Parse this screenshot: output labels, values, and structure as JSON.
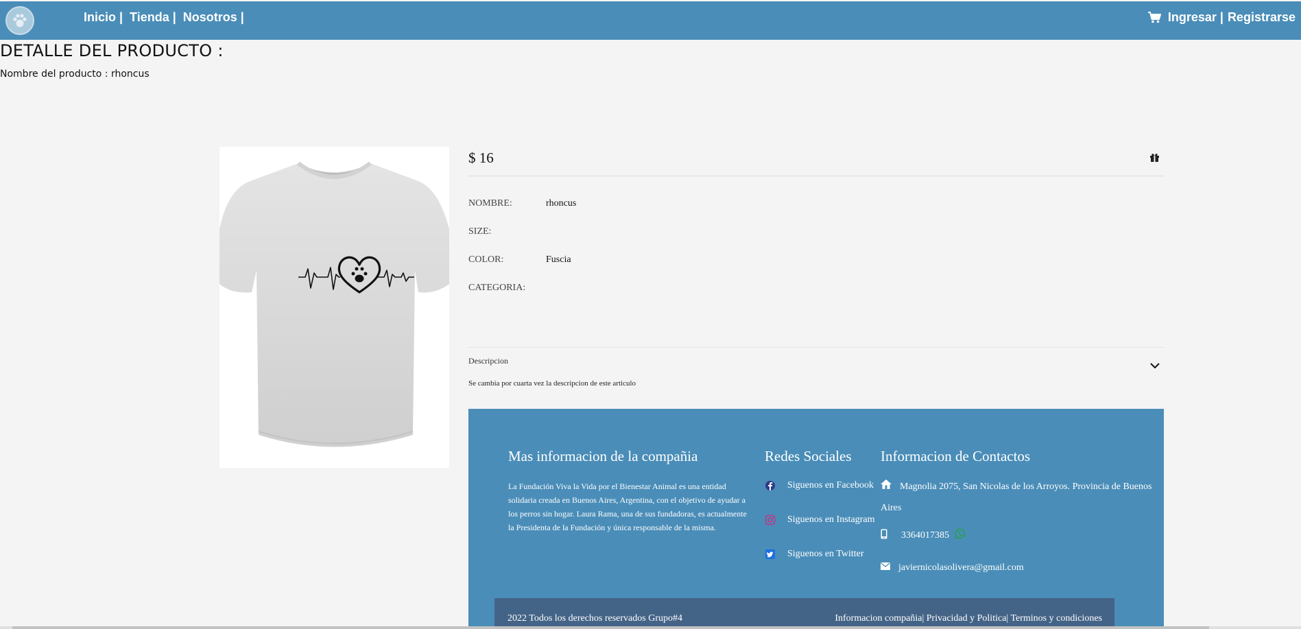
{
  "nav": {
    "logo_icon": "paw-icon",
    "links": [
      "Inicio |",
      "Tienda |",
      "Nosotros |"
    ],
    "cart_icon": "cart-icon",
    "login": "Ingresar |",
    "register": "Registrarse"
  },
  "page": {
    "heading": "DETALLE DEL PRODUCTO :",
    "product_name_line": "Nombre del producto : rhoncus"
  },
  "product": {
    "image": "t-shirt-heartbeat-paw",
    "price": "$ 16",
    "gift_icon": "gift-icon",
    "specs": [
      {
        "label": "NOMBRE:",
        "value": "rhoncus"
      },
      {
        "label": "SIZE:",
        "value": ""
      },
      {
        "label": "COLOR:",
        "value": "Fuscia"
      },
      {
        "label": "CATEGORIA:",
        "value": ""
      }
    ],
    "description_title": "Descripcion",
    "description_text": "Se cambia por cuarta vez la descripcion de este articulo"
  },
  "footer": {
    "about_title": "Mas informacion de la compañia",
    "about_text": "La Fundación Viva la Vida por el Bienestar Animal es una entidad solidaria creada en Buenos Aires, Argentina, con el objetivo de ayudar a los perros sin hogar. Laura Rama, una de sus fundadoras, es actualmente la Presidenta de la Fundación y única responsable de la misma.",
    "social_title": "Redes Sociales",
    "social": [
      {
        "label": "Siguenos en Facebook",
        "icon": "facebook-icon",
        "color": "#2d3a8c"
      },
      {
        "label": "Siguenos en Instagram",
        "icon": "instagram-icon",
        "color": "#c13584"
      },
      {
        "label": "Siguenos en Twitter",
        "icon": "twitter-icon",
        "color": "#1d6fe0"
      }
    ],
    "contact_title": "Informacion de Contactos",
    "address": "Magnolia 2075, San Nicolas de los Arroyos. Provincia de Buenos Aires",
    "phone": "3364017385",
    "email": "javiernicolasolivera@gmail.com",
    "copyright": "2022 Todos los derechos reservados Grupo#4",
    "legal": "Informacion compañia| Privacidad y Politica| Terminos y condiciones"
  },
  "colors": {
    "nav_bg": "#4a8db8",
    "footer_bg": "#4a8db8",
    "bottom_bar_bg": "#446487",
    "page_bg": "#f4f4f4"
  }
}
